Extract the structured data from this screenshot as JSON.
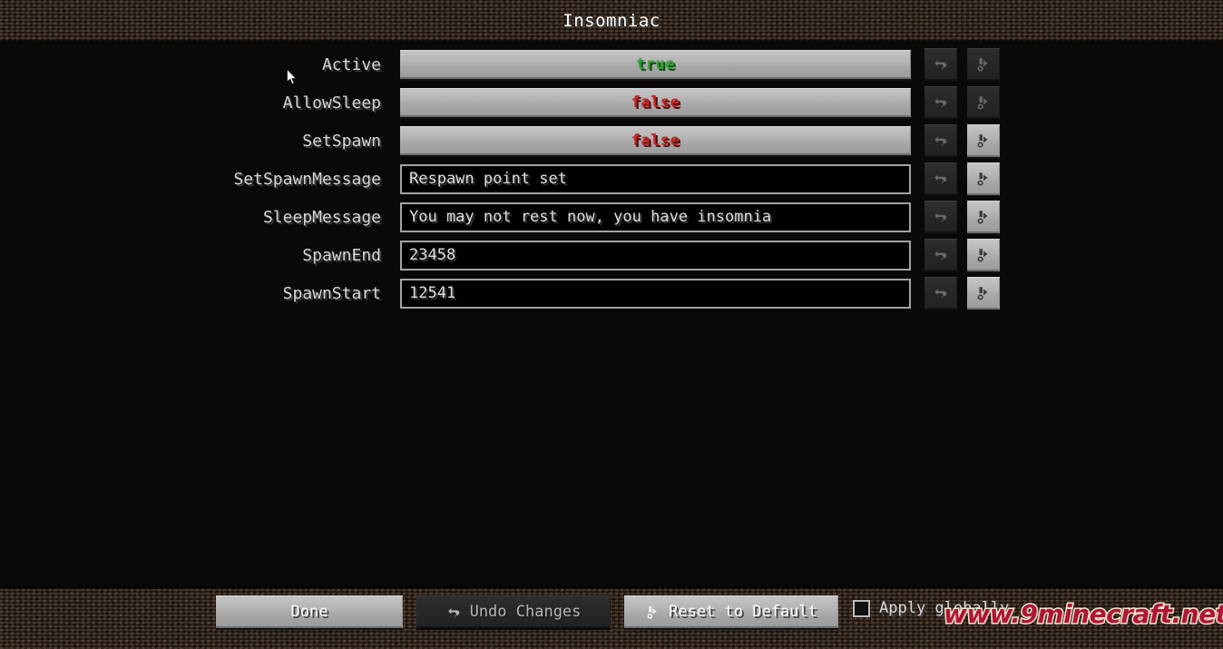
{
  "header": {
    "title": "Insomniac"
  },
  "rows": [
    {
      "label": "Active",
      "type": "boolean",
      "value": "true",
      "undo_enabled": false,
      "reset_enabled": false
    },
    {
      "label": "AllowSleep",
      "type": "boolean",
      "value": "false",
      "undo_enabled": false,
      "reset_enabled": false
    },
    {
      "label": "SetSpawn",
      "type": "boolean",
      "value": "false",
      "undo_enabled": false,
      "reset_enabled": true
    },
    {
      "label": "SetSpawnMessage",
      "type": "text",
      "value": "Respawn point set",
      "undo_enabled": false,
      "reset_enabled": true
    },
    {
      "label": "SleepMessage",
      "type": "text",
      "value": "You may not rest now, you have insomnia",
      "undo_enabled": false,
      "reset_enabled": true
    },
    {
      "label": "SpawnEnd",
      "type": "text",
      "value": "23458",
      "undo_enabled": false,
      "reset_enabled": true
    },
    {
      "label": "SpawnStart",
      "type": "text",
      "value": "12541",
      "undo_enabled": false,
      "reset_enabled": true
    }
  ],
  "row_icons": {
    "undo_icon": "undo-arrow-icon",
    "reset_icon": "reset-to-default-icon"
  },
  "footer": {
    "done_label": "Done",
    "undo_changes_label": "Undo Changes",
    "reset_default_label": "Reset to Default",
    "apply_global_label": "Apply globally",
    "apply_global_checked": false
  },
  "watermark": {
    "text": "www.9minecraft.net"
  },
  "colors": {
    "true_green": "#2fa52f",
    "false_red": "#c72222",
    "header_dirt": "#3a2a1e",
    "body_dirt": "#100c09",
    "button_face": "#b5b5b5",
    "watermark_red": "#b01438"
  }
}
